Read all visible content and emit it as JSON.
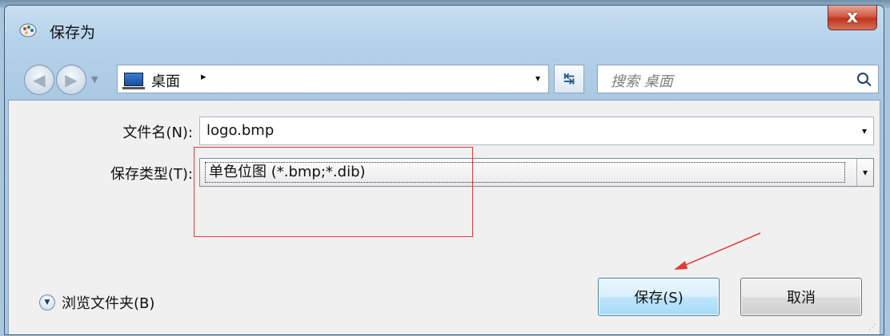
{
  "window": {
    "title": "保存为",
    "close_label": "x"
  },
  "nav": {
    "back_label": "back",
    "forward_label": "forward"
  },
  "address": {
    "location": "桌面",
    "arrow": "▸",
    "dropdown": "▾"
  },
  "search": {
    "placeholder": "搜索 桌面"
  },
  "form": {
    "filename_label": "文件名(N):",
    "filename_value": "logo.bmp",
    "filetype_label": "保存类型(T):",
    "filetype_value": "单色位图 (*.bmp;*.dib)",
    "dropdown_glyph": "▾"
  },
  "footer": {
    "browse_label": "浏览文件夹(B)",
    "save_label": "保存(S)",
    "cancel_label": "取消"
  },
  "annotations": {
    "highlight_color": "#e23a3a",
    "arrow_color": "#e23a3a"
  },
  "icons": {
    "title": "paint-palette-icon",
    "location": "desktop-icon",
    "refresh": "refresh-icon",
    "search": "search-icon",
    "expand": "expand-icon"
  }
}
